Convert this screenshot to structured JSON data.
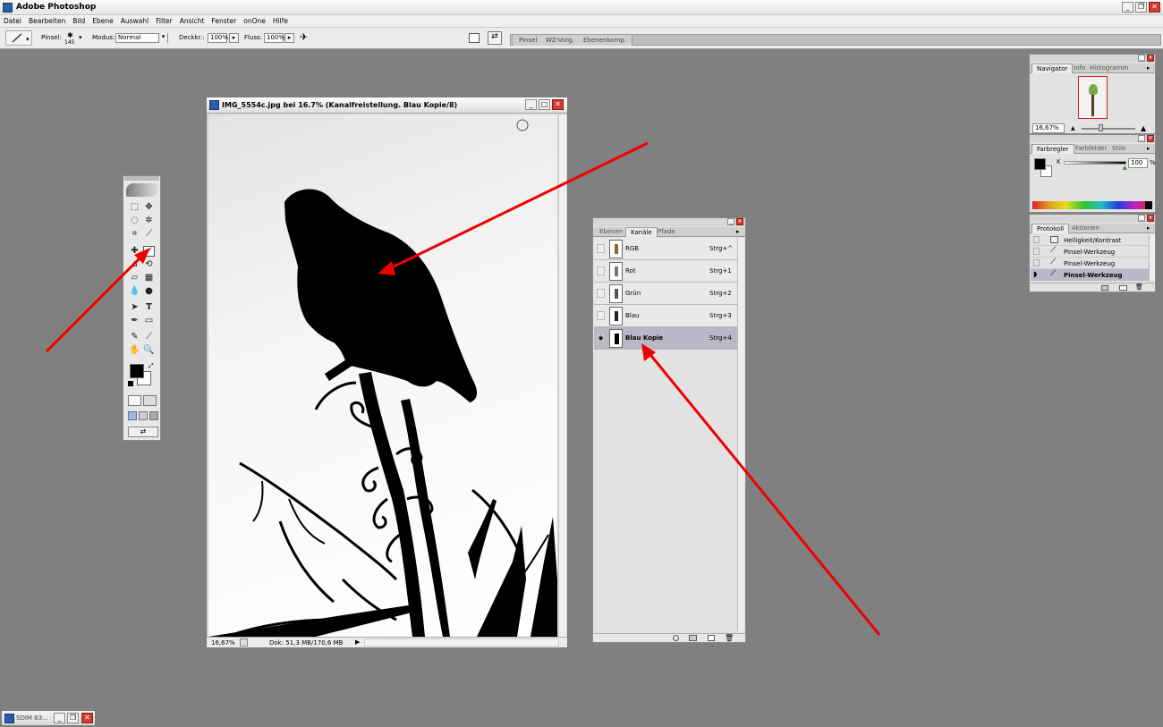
{
  "app": {
    "title": "Adobe Photoshop"
  },
  "menu": [
    "Datei",
    "Bearbeiten",
    "Bild",
    "Ebene",
    "Auswahl",
    "Filter",
    "Ansicht",
    "Fenster",
    "onOne",
    "Hilfe"
  ],
  "options": {
    "brush_label": "Pinsel:",
    "brush_size": "145",
    "mode_label": "Modus:",
    "mode_value": "Normal",
    "opacity_label": "Deckkr.:",
    "opacity_value": "100%",
    "flow_label": "Fluss:",
    "flow_value": "100%"
  },
  "palette_well": {
    "tabs": [
      "Pinsel",
      "WZ-Vorg.",
      "Ebenenkomp."
    ]
  },
  "document": {
    "title": "IMG_5554c.jpg bei 16.7% (Kanalfreistellung. Blau Kopie/8)",
    "zoom": "16,67%",
    "doc_info": "Dok: 51,3 MB/170,6 MB"
  },
  "channels_panel": {
    "tabs": [
      "Ebenen",
      "Kanäle",
      "Pfade"
    ],
    "active_tab": "Kanäle",
    "channels": [
      {
        "name": "RGB",
        "shortcut": "Strg+^",
        "visible": false,
        "selected": false
      },
      {
        "name": "Rot",
        "shortcut": "Strg+1",
        "visible": false,
        "selected": false
      },
      {
        "name": "Grün",
        "shortcut": "Strg+2",
        "visible": false,
        "selected": false
      },
      {
        "name": "Blau",
        "shortcut": "Strg+3",
        "visible": false,
        "selected": false
      },
      {
        "name": "Blau Kopie",
        "shortcut": "Strg+4",
        "visible": true,
        "selected": true
      }
    ]
  },
  "navigator_panel": {
    "tabs": [
      "Navigator",
      "Info",
      "Histogramm"
    ],
    "zoom": "16,67%"
  },
  "color_panel": {
    "tabs": [
      "Farbregler",
      "Farbfelder",
      "Stile"
    ],
    "channel_label": "K",
    "value": "100",
    "unit": "%"
  },
  "history_panel": {
    "tabs": [
      "Protokoll",
      "Aktionen"
    ],
    "items": [
      "Helligkeit/Kontrast",
      "Pinsel-Werkzeug",
      "Pinsel-Werkzeug",
      "Pinsel-Werkzeug"
    ]
  },
  "taskbar": {
    "label": "SDIM 83..."
  },
  "colors": {
    "arrow": "#ee0000",
    "accent_selection": "#b8b8c6",
    "close_button": "#d23a2f"
  },
  "icons": [
    "brush-icon",
    "eye-icon",
    "close-icon",
    "minimize-icon",
    "maximize-icon"
  ]
}
